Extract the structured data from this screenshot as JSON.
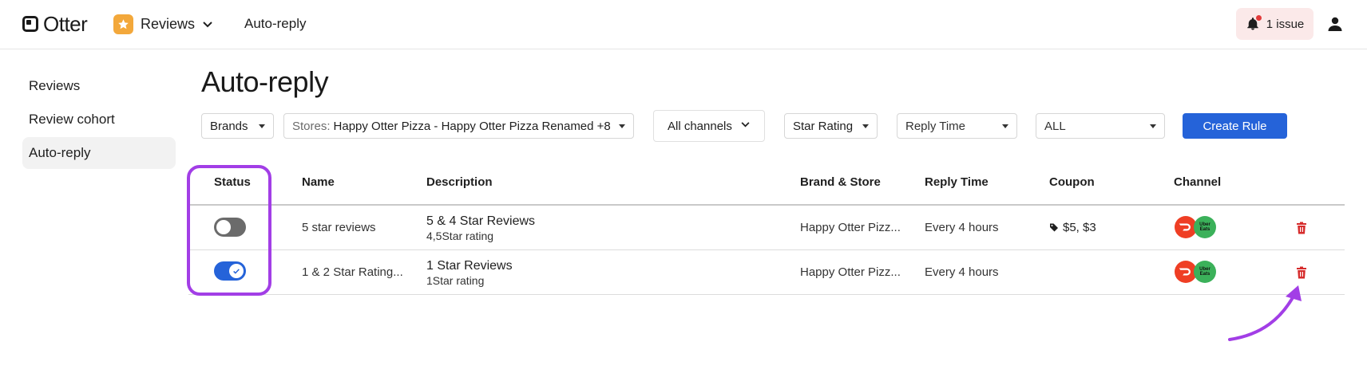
{
  "header": {
    "logo_text": "Otter",
    "product": "Reviews",
    "crumb": "Auto-reply",
    "issues_label": "1 issue"
  },
  "sidebar": {
    "items": [
      {
        "label": "Reviews",
        "active": false
      },
      {
        "label": "Review cohort",
        "active": false
      },
      {
        "label": "Auto-reply",
        "active": true
      }
    ]
  },
  "page": {
    "title": "Auto-reply"
  },
  "filters": {
    "brands": "Brands",
    "stores_prefix": "Stores:",
    "stores_value": "Happy Otter Pizza - Happy Otter Pizza Renamed +8",
    "channels": "All channels",
    "star_rating": "Star Rating",
    "reply_time": "Reply Time",
    "all": "ALL",
    "create_rule": "Create Rule"
  },
  "table": {
    "columns": [
      "Status",
      "Name",
      "Description",
      "Brand & Store",
      "Reply Time",
      "Coupon",
      "Channel"
    ],
    "rows": [
      {
        "enabled": false,
        "name": "5 star reviews",
        "desc_title": "5 & 4 Star Reviews",
        "desc_sub": "4,5Star rating",
        "brand_store": "Happy Otter Pizz...",
        "reply_time": "Every 4 hours",
        "coupon": "$5, $3",
        "channels": [
          "doordash",
          "uber-eats"
        ]
      },
      {
        "enabled": true,
        "name": "1 & 2 Star Rating...",
        "desc_title": "1 Star Reviews",
        "desc_sub": "1Star rating",
        "brand_store": "Happy Otter Pizz...",
        "reply_time": "Every 4 hours",
        "coupon": "",
        "channels": [
          "doordash",
          "uber-eats"
        ]
      }
    ]
  },
  "channel_badges": {
    "uber_eats_text_1": "Uber",
    "uber_eats_text_2": "Eats"
  },
  "colors": {
    "accent": "#2563d9",
    "highlight": "#a23ee6",
    "delete": "#d62b2b"
  }
}
